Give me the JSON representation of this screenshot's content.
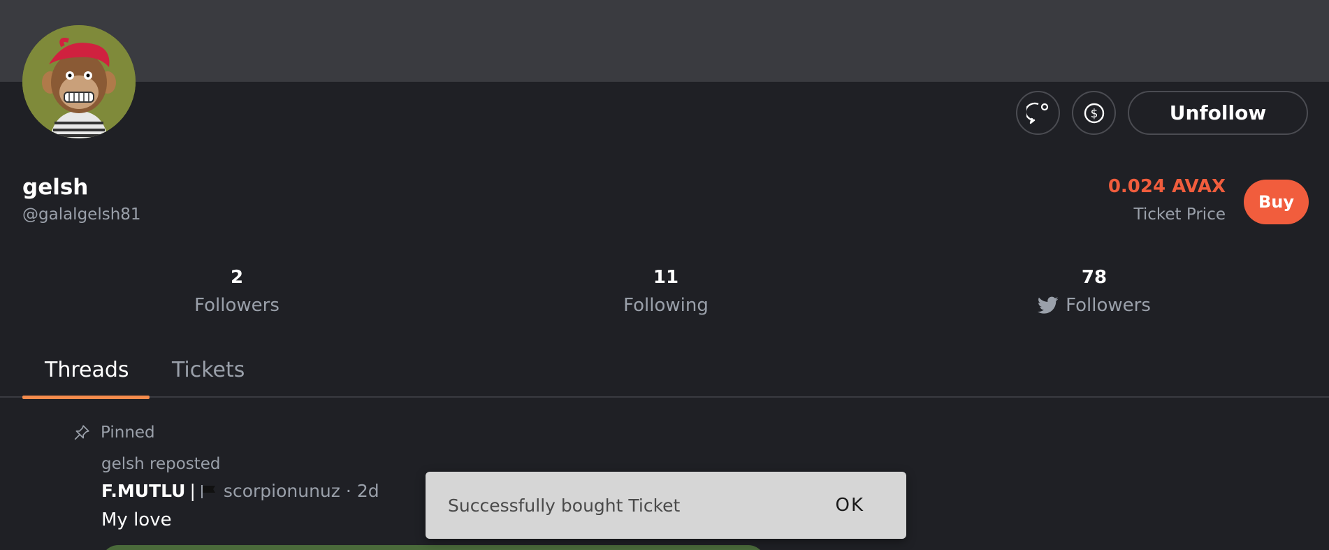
{
  "profile": {
    "display_name": "gelsh",
    "handle": "@galalgelsh81",
    "avatar_icon": "ape-avatar"
  },
  "actions": {
    "chat_icon": "chat-bubble-icon",
    "tip_icon": "dollar-circle-icon",
    "unfollow_label": "Unfollow"
  },
  "ticket": {
    "price": "0.024 AVAX",
    "price_label": "Ticket Price",
    "buy_label": "Buy",
    "accent_color": "#f15d3d"
  },
  "stats": [
    {
      "count": "2",
      "label": "Followers"
    },
    {
      "count": "11",
      "label": "Following"
    },
    {
      "count": "78",
      "label": "Followers",
      "icon": "twitter-bird-icon"
    }
  ],
  "tabs": [
    {
      "label": "Threads",
      "active": true
    },
    {
      "label": "Tickets",
      "active": false
    }
  ],
  "tab_accent_color": "#f58b4c",
  "post": {
    "pinned_label": "Pinned",
    "repost_label": "gelsh reposted",
    "author": "F.MUTLU",
    "separator": "|",
    "flag_icon": "black-flag-icon",
    "author_handle": "scorpionunuz",
    "dot": "·",
    "time": "2d",
    "body": "My love"
  },
  "snackbar": {
    "message": "Successfully bought Ticket",
    "action_label": "OK"
  }
}
